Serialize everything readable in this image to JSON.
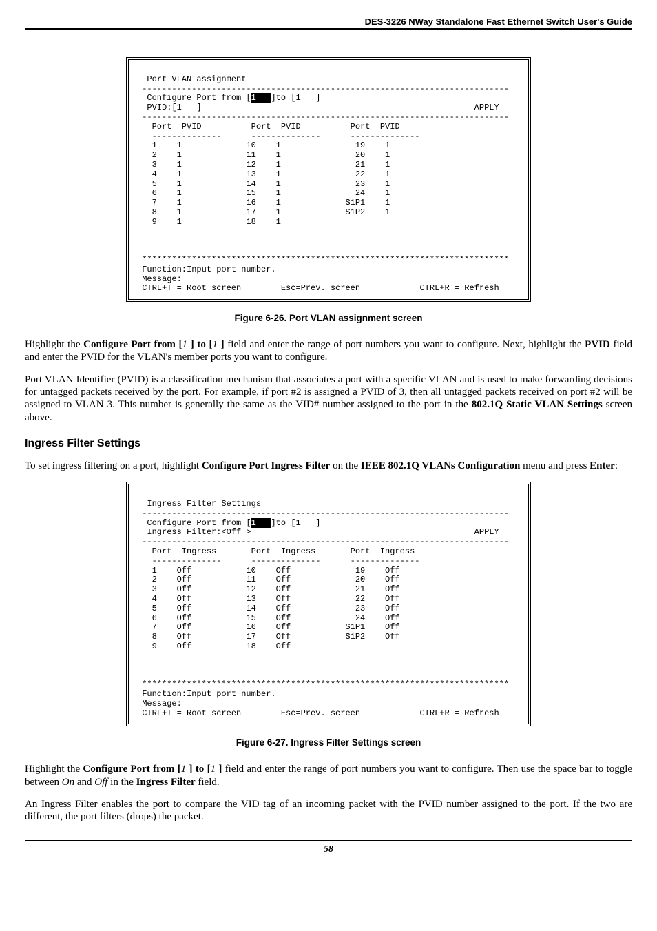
{
  "header": {
    "guide_title": "DES-3226 NWay Standalone Fast Ethernet Switch User's Guide"
  },
  "fig1": {
    "caption": "Figure 6-26.  Port VLAN assignment screen",
    "terminal": {
      "title": "Port VLAN assignment",
      "configure_line_prefix": "Configure Port from [",
      "configure_line_mid": "]to [1   ]",
      "pvid_line": "PVID:[1   ]",
      "apply_label": "APPLY",
      "col_port": "Port",
      "col_pvid": "PVID",
      "rows_col1": [
        {
          "port": "1",
          "pvid": "1"
        },
        {
          "port": "2",
          "pvid": "1"
        },
        {
          "port": "3",
          "pvid": "1"
        },
        {
          "port": "4",
          "pvid": "1"
        },
        {
          "port": "5",
          "pvid": "1"
        },
        {
          "port": "6",
          "pvid": "1"
        },
        {
          "port": "7",
          "pvid": "1"
        },
        {
          "port": "8",
          "pvid": "1"
        },
        {
          "port": "9",
          "pvid": "1"
        }
      ],
      "rows_col2": [
        {
          "port": "10",
          "pvid": "1"
        },
        {
          "port": "11",
          "pvid": "1"
        },
        {
          "port": "12",
          "pvid": "1"
        },
        {
          "port": "13",
          "pvid": "1"
        },
        {
          "port": "14",
          "pvid": "1"
        },
        {
          "port": "15",
          "pvid": "1"
        },
        {
          "port": "16",
          "pvid": "1"
        },
        {
          "port": "17",
          "pvid": "1"
        },
        {
          "port": "18",
          "pvid": "1"
        }
      ],
      "rows_col3": [
        {
          "port": "19",
          "pvid": "1"
        },
        {
          "port": "20",
          "pvid": "1"
        },
        {
          "port": "21",
          "pvid": "1"
        },
        {
          "port": "22",
          "pvid": "1"
        },
        {
          "port": "23",
          "pvid": "1"
        },
        {
          "port": "24",
          "pvid": "1"
        },
        {
          "port": "S1P1",
          "pvid": "1"
        },
        {
          "port": "S1P2",
          "pvid": "1"
        }
      ],
      "function_line": "Function:Input port number.",
      "message_line": "Message:",
      "footer_left": "CTRL+T = Root screen",
      "footer_mid": "Esc=Prev. screen",
      "footer_right": "CTRL+R = Refresh"
    }
  },
  "para1": {
    "t1": "Highlight the ",
    "b1": "Configure Port from [",
    "i1": "1 ",
    "b2": "] to [",
    "i2": "1 ",
    "b3": "]",
    "t2": " field and enter the range of port numbers you want to configure. Next, highlight the ",
    "b4": "PVID",
    "t3": " field and enter the PVID for the VLAN's member ports you want to configure."
  },
  "para2": {
    "t1": "Port VLAN Identifier (PVID) is a classification mechanism that associates a port with a specific VLAN and is used to make forwarding decisions for untagged packets received by the port. For example, if port #2 is assigned a PVID of 3, then all untagged packets received on port #2 will be assigned to VLAN 3. This number is generally the same as the VID# number assigned to the port in the ",
    "b1": "802.1Q Static VLAN Settings",
    "t2": " screen above."
  },
  "section_heading": "Ingress Filter Settings",
  "para3": {
    "t1": "To set ingress filtering on a port, highlight ",
    "b1": "Configure Port Ingress Filter",
    "t2": " on the ",
    "b2": "IEEE 802.1Q VLANs Configuration",
    "t3": " menu and press ",
    "b3": "Enter",
    "t4": ":"
  },
  "fig2": {
    "caption": "Figure 6-27.  Ingress Filter Settings screen",
    "terminal": {
      "title": "Ingress Filter Settings",
      "configure_line_prefix": "Configure Port from [",
      "configure_line_mid": "]to [1   ]",
      "filter_line": "Ingress Filter:<Off >",
      "apply_label": "APPLY",
      "col_port": "Port",
      "col_ingress": "Ingress",
      "rows_col1": [
        {
          "port": "1",
          "ing": "Off"
        },
        {
          "port": "2",
          "ing": "Off"
        },
        {
          "port": "3",
          "ing": "Off"
        },
        {
          "port": "4",
          "ing": "Off"
        },
        {
          "port": "5",
          "ing": "Off"
        },
        {
          "port": "6",
          "ing": "Off"
        },
        {
          "port": "7",
          "ing": "Off"
        },
        {
          "port": "8",
          "ing": "Off"
        },
        {
          "port": "9",
          "ing": "Off"
        }
      ],
      "rows_col2": [
        {
          "port": "10",
          "ing": "Off"
        },
        {
          "port": "11",
          "ing": "Off"
        },
        {
          "port": "12",
          "ing": "Off"
        },
        {
          "port": "13",
          "ing": "Off"
        },
        {
          "port": "14",
          "ing": "Off"
        },
        {
          "port": "15",
          "ing": "Off"
        },
        {
          "port": "16",
          "ing": "Off"
        },
        {
          "port": "17",
          "ing": "Off"
        },
        {
          "port": "18",
          "ing": "Off"
        }
      ],
      "rows_col3": [
        {
          "port": "19",
          "ing": "Off"
        },
        {
          "port": "20",
          "ing": "Off"
        },
        {
          "port": "21",
          "ing": "Off"
        },
        {
          "port": "22",
          "ing": "Off"
        },
        {
          "port": "23",
          "ing": "Off"
        },
        {
          "port": "24",
          "ing": "Off"
        },
        {
          "port": "S1P1",
          "ing": "Off"
        },
        {
          "port": "S1P2",
          "ing": "Off"
        }
      ],
      "function_line": "Function:Input port number.",
      "message_line": "Message:",
      "footer_left": "CTRL+T = Root screen",
      "footer_mid": "Esc=Prev. screen",
      "footer_right": "CTRL+R = Refresh"
    }
  },
  "para4": {
    "t1": "Highlight the ",
    "b1": "Configure Port from [",
    "i1": "1 ",
    "b2": "] to [",
    "i2": "1 ",
    "b3": "]",
    "t2": " field and enter the range of port numbers you want to configure. Then use the space bar to toggle between ",
    "i3": "On",
    "t3": " and ",
    "i4": "Off",
    "t4": " in the ",
    "b4": "Ingress Filter",
    "t5": " field."
  },
  "para5": {
    "t1": "An Ingress Filter enables the port to compare the VID tag of an incoming packet with the PVID number assigned to the port. If the two are different, the port filters (drops) the packet."
  },
  "page_number": "58"
}
